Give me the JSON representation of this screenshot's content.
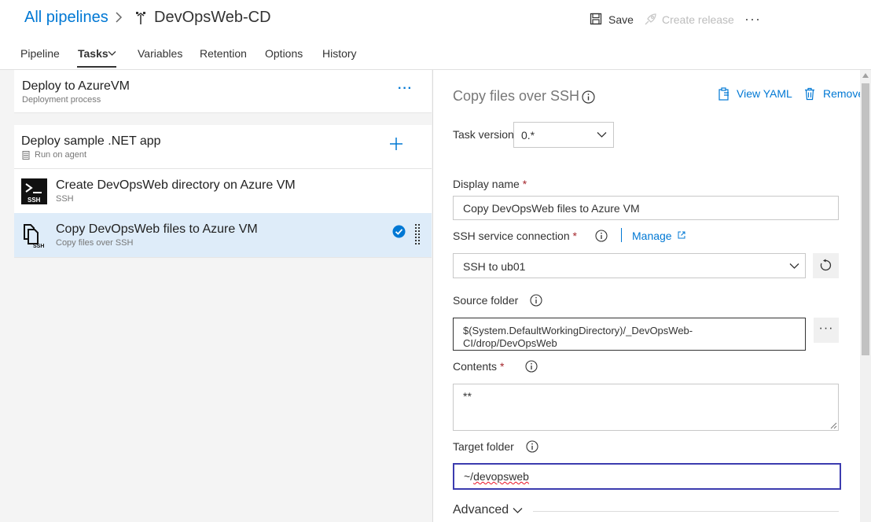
{
  "header": {
    "breadcrumb": "All pipelines",
    "pipeline_name": "DevOpsWeb-CD",
    "save_label": "Save",
    "create_release_label": "Create release",
    "more": "···"
  },
  "tabs": [
    {
      "label": "Pipeline"
    },
    {
      "label": "Tasks"
    },
    {
      "label": "Variables"
    },
    {
      "label": "Retention"
    },
    {
      "label": "Options"
    },
    {
      "label": "History"
    }
  ],
  "stage": {
    "title": "Deploy to AzureVM",
    "subtitle": "Deployment process",
    "more": "···"
  },
  "job": {
    "title": "Deploy sample .NET app",
    "subtitle": "Run on agent"
  },
  "tasks": [
    {
      "title": "Create DevOpsWeb directory on Azure VM",
      "subtitle": "SSH",
      "icon": "ssh-terminal-icon"
    },
    {
      "title": "Copy DevOpsWeb files to Azure VM",
      "subtitle": "Copy files over SSH",
      "icon": "copy-files-ssh-icon",
      "selected": true
    }
  ],
  "panel": {
    "title": "Copy files over SSH",
    "view_yaml": "View YAML",
    "remove": "Remove",
    "task_version_label": "Task version",
    "task_version_value": "0.*",
    "display_name_label": "Display name",
    "display_name_value": "Copy DevOpsWeb files to Azure VM",
    "ssh_connection_label": "SSH service connection",
    "manage": "Manage",
    "ssh_connection_value": "SSH to ub01",
    "source_folder_label": "Source folder",
    "source_folder_value_line1": "$(System.DefaultWorkingDirectory)/_DevOpsWeb-",
    "source_folder_value_line2": "CI/drop/DevOpsWeb",
    "contents_label": "Contents",
    "contents_value": "**",
    "target_folder_label": "Target folder",
    "target_folder_value_prefix": "~/",
    "target_folder_value_word": "devopsweb",
    "advanced_label": "Advanced",
    "required_mark": "*",
    "browse": "···"
  },
  "colors": {
    "accent": "#0078d4",
    "selected_row": "#deecf9",
    "focus_border": "#3c3caf",
    "required": "#a4262c"
  }
}
